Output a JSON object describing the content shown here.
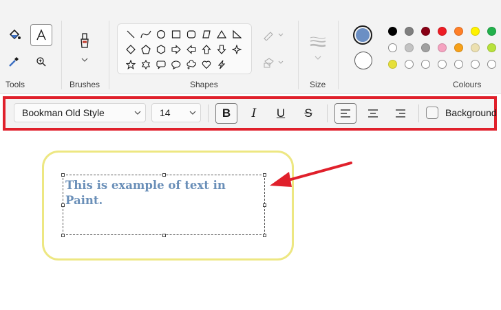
{
  "ribbon": {
    "groups": {
      "tools": "Tools",
      "brushes": "Brushes",
      "shapes": "Shapes",
      "size": "Size",
      "colours": "Colours"
    },
    "tool_icons": [
      "fill-icon",
      "text-icon",
      "color-picker-icon",
      "magnifier-icon"
    ],
    "shape_icons": [
      "line",
      "curve",
      "oval",
      "rectangle",
      "rounded-rectangle",
      "polygon",
      "triangle",
      "right-triangle",
      "diamond",
      "pentagon",
      "hexagon",
      "right-arrow",
      "left-arrow",
      "up-arrow",
      "down-arrow",
      "four-point-star",
      "five-point-star",
      "six-point-star",
      "rounded-callout",
      "oval-callout",
      "cloud-callout",
      "heart",
      "lightning"
    ],
    "colours": {
      "primary": "#6b8fc4",
      "secondary": "#ffffff",
      "row1": [
        "#000000",
        "#7f7f7f",
        "#880015",
        "#ed1c24",
        "#ff7f27",
        "#fff200",
        "#22b14c"
      ],
      "row2": [
        "#ffffff",
        "#c3c3c3",
        "#b97a57",
        "#ffaec9",
        "#ffc90e",
        "#efe4b0",
        "#b5e61d"
      ],
      "row2_visible": [
        "#ffffff",
        "#c3c3c3",
        "#a0a0a0",
        "#f5a3c0",
        "#f7a11a",
        "#ece0b0",
        "#b8e23c"
      ],
      "row3": [
        "#e6e03a",
        "#ffffff",
        "#ffffff",
        "#ffffff",
        "#ffffff",
        "#ffffff",
        "#ffffff"
      ]
    }
  },
  "text_toolbar": {
    "font_family": "Bookman Old Style",
    "font_size": "14",
    "bold_label": "B",
    "italic_label": "I",
    "underline_label": "U",
    "strike_label": "S",
    "background_label": "Background",
    "accent_border": "#e0202b"
  },
  "canvas": {
    "text": "This is example of text in Paint.",
    "text_color": "#6a8fb8",
    "highlight_color": "#ede782",
    "arrow_color": "#e0202b"
  }
}
